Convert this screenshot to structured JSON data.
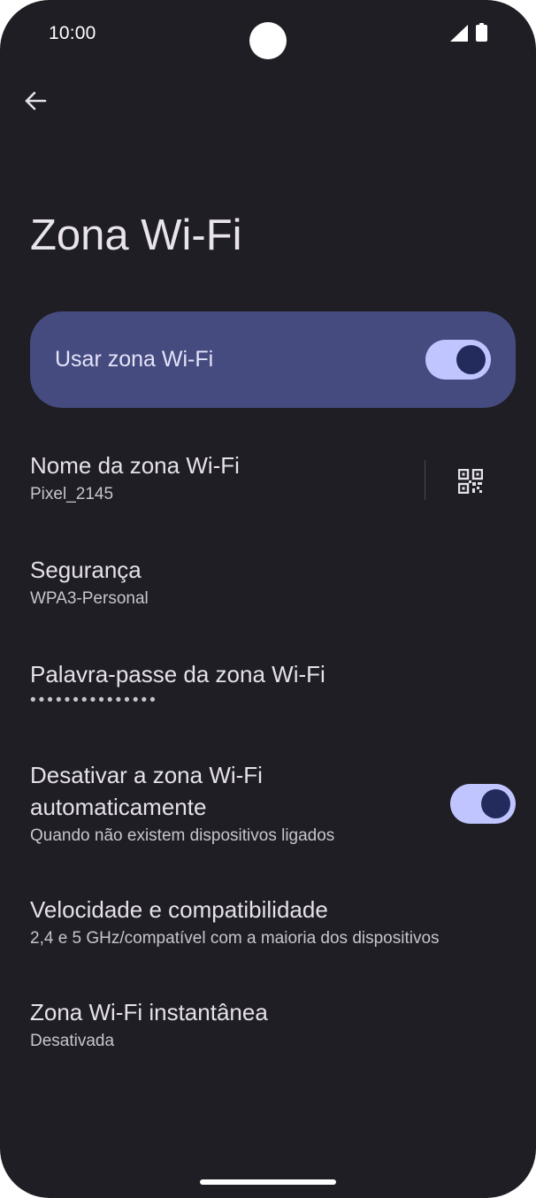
{
  "status_bar": {
    "time": "10:00",
    "icons": [
      "signal-icon",
      "battery-icon"
    ]
  },
  "nav": {
    "back_icon": "arrow-back-icon"
  },
  "page": {
    "title": "Zona Wi-Fi"
  },
  "main_switch": {
    "label": "Usar zona Wi-Fi",
    "checked": true
  },
  "settings": {
    "hotspot_name": {
      "title": "Nome da zona Wi-Fi",
      "summary": "Pixel_2145",
      "action_icon": "qr-code-icon"
    },
    "security": {
      "title": "Segurança",
      "summary": "WPA3-Personal"
    },
    "password": {
      "title": "Palavra-passe da zona Wi-Fi",
      "summary": "•••••••••••••••"
    },
    "auto_off": {
      "title": "Desativar a zona Wi-Fi automaticamente",
      "summary": "Quando não existem dispositivos ligados",
      "checked": true
    },
    "speed": {
      "title": "Velocidade e compatibilidade",
      "summary": "2,4 e 5 GHz/compatível com a maioria dos dispositivos"
    },
    "instant_hotspot": {
      "title": "Zona Wi-Fi instantânea",
      "summary": "Desativada"
    }
  },
  "colors": {
    "background": "#1f1e24",
    "card": "#454b7e",
    "switch_track": "#c0c5ff",
    "switch_thumb": "#232a5c",
    "text_primary": "#e6e1e9",
    "text_secondary": "#c7c4ce"
  }
}
